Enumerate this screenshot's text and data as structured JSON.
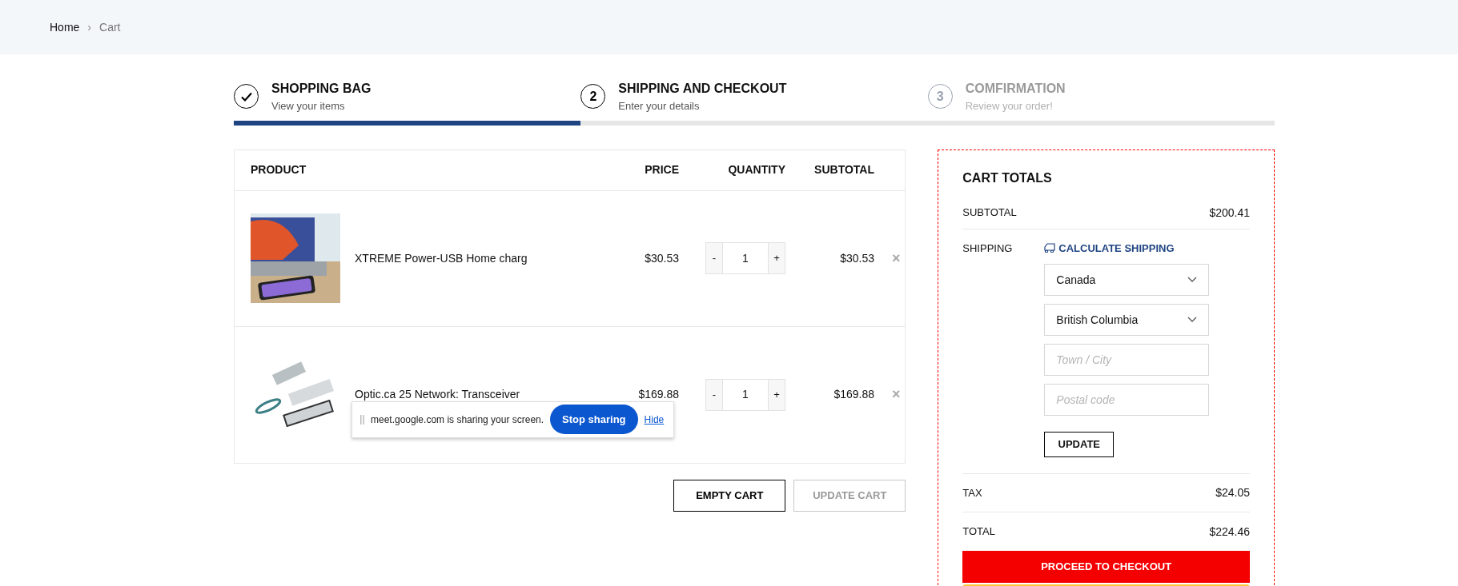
{
  "breadcrumb": [
    {
      "label": "Home",
      "current": false
    },
    {
      "label": "Cart",
      "current": true
    }
  ],
  "breadcrumb_separator": "›",
  "steps": [
    {
      "completed": true,
      "enabled": true,
      "title": "SHOPPING BAG",
      "subtitle": "View your items"
    },
    {
      "completed": false,
      "enabled": true,
      "number": "2",
      "title": "SHIPPING AND CHECKOUT",
      "subtitle": "Enter your details"
    },
    {
      "completed": false,
      "enabled": false,
      "number": "3",
      "title": "COMFIRMATION",
      "subtitle": "Review your order!"
    }
  ],
  "cart_table": {
    "columns": [
      "PRODUCT",
      "PRICE",
      "QUANTITY",
      "SUBTOTAL"
    ],
    "rows": [
      {
        "name": "XTREME Power-USB Home charg",
        "price": "$30.53",
        "quantity": "1",
        "subtotal": "$30.53"
      },
      {
        "name": "Optic.ca 25 Network: Transceiver",
        "price": "$169.88",
        "quantity": "1",
        "subtotal": "$169.88"
      }
    ],
    "minus": "-",
    "plus": "+",
    "remove": "×"
  },
  "cart_buttons": [
    {
      "label": "EMPTY CART",
      "disabled": false
    },
    {
      "label": "UPDATE CART",
      "disabled": true
    }
  ],
  "screen_share_bar": {
    "message": "meet.google.com is sharing your screen.",
    "stop_button": "Stop sharing",
    "hide_link": "Hide"
  },
  "cart_totals": {
    "title": "CART TOTALS",
    "subtotal_label": "SUBTOTAL",
    "subtotal": "$200.41",
    "shipping_label": "SHIPPING",
    "calculate_shipping": "CALCULATE SHIPPING",
    "country": "Canada",
    "province": "British Columbia",
    "city_placeholder": "Town / City",
    "postal_placeholder": "Postal code",
    "update_button": "UPDATE",
    "tax_label": "TAX",
    "tax": "$24.05",
    "total_label": "TOTAL",
    "total": "$224.46",
    "checkout_button": "PROCEED TO CHECKOUT"
  }
}
